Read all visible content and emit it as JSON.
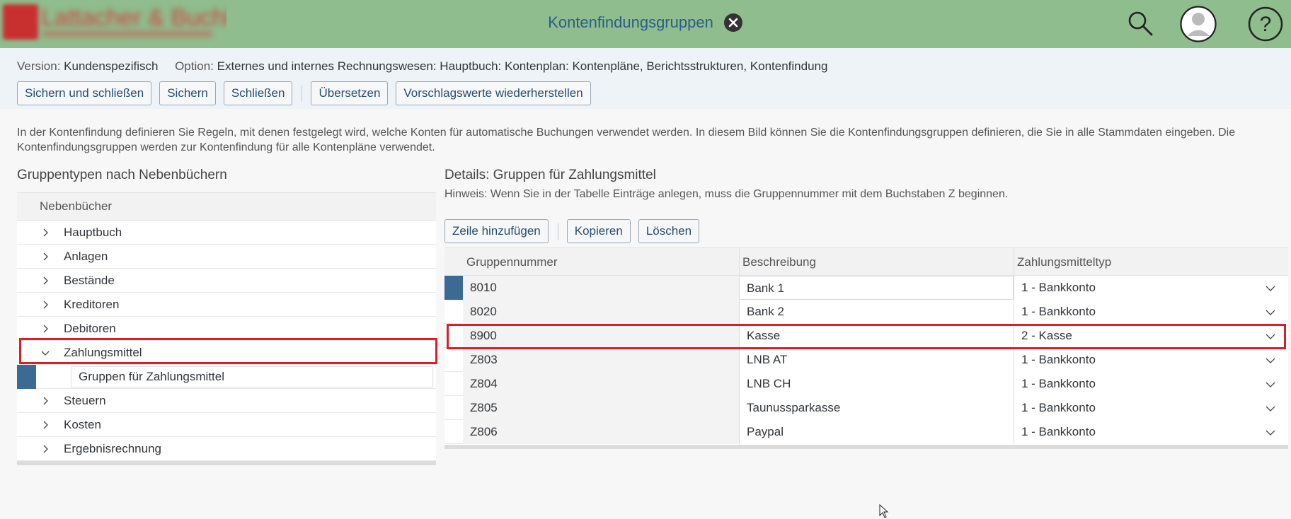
{
  "shell": {
    "title": "Kontenfindungsgruppen",
    "logo_text": "Lattacher & Buchl",
    "icons": [
      "close-icon",
      "search-icon",
      "avatar-icon",
      "help-icon"
    ]
  },
  "subheader": {
    "version_label": "Version:",
    "version_value": "Kundenspezifisch",
    "option_label": "Option:",
    "option_value": "Externes und internes Rechnungswesen: Hauptbuch: Kontenplan: Kontenpläne, Berichtsstrukturen, Kontenfindung",
    "buttons": {
      "save_close": "Sichern und schließen",
      "save": "Sichern",
      "close": "Schließen",
      "translate": "Übersetzen",
      "restore": "Vorschlagswerte wiederherstellen"
    }
  },
  "description": "In der Kontenfindung definieren Sie Regeln, mit denen festgelegt wird, welche Konten für automatische Buchungen verwendet werden. In diesem Bild können Sie die Kontenfindungsgruppen definieren, die Sie in alle Stammdaten eingeben. Die Kontenfindungsgruppen werden zur Kontenfindung für alle Kontenpläne verwendet.",
  "left": {
    "title": "Gruppentypen nach Nebenbüchern",
    "column_header": "Nebenbücher",
    "items": [
      {
        "label": "Hauptbuch",
        "expanded": false
      },
      {
        "label": "Anlagen",
        "expanded": false
      },
      {
        "label": "Bestände",
        "expanded": false
      },
      {
        "label": "Kreditoren",
        "expanded": false
      },
      {
        "label": "Debitoren",
        "expanded": false
      },
      {
        "label": "Zahlungsmittel",
        "expanded": true
      },
      {
        "label": "Gruppen für Zahlungsmittel",
        "child": true
      },
      {
        "label": "Steuern",
        "expanded": false
      },
      {
        "label": "Kosten",
        "expanded": false
      },
      {
        "label": "Ergebnisrechnung",
        "expanded": false
      }
    ]
  },
  "right": {
    "title": "Details: Gruppen für Zahlungsmittel",
    "hint": "Hinweis: Wenn Sie in der Tabelle Einträge anlegen, muss die Gruppennummer mit dem Buchstaben Z beginnen.",
    "buttons": {
      "add_row": "Zeile hinzufügen",
      "copy": "Kopieren",
      "delete": "Löschen"
    },
    "columns": [
      "Gruppennummer",
      "Beschreibung",
      "Zahlungsmitteltyp"
    ],
    "rows": [
      {
        "number": "8010",
        "description": "Bank 1",
        "type": "1 - Bankkonto",
        "selected": true
      },
      {
        "number": "8020",
        "description": "Bank 2",
        "type": "1 - Bankkonto"
      },
      {
        "number": "8900",
        "description": "Kasse",
        "type": "2 - Kasse",
        "highlighted": true
      },
      {
        "number": "Z803",
        "description": "LNB AT",
        "type": "1 - Bankkonto"
      },
      {
        "number": "Z804",
        "description": "LNB CH",
        "type": "1 - Bankkonto"
      },
      {
        "number": "Z805",
        "description": "Taunussparkasse",
        "type": "1 - Bankkonto"
      },
      {
        "number": "Z806",
        "description": "Paypal",
        "type": "1 - Bankkonto"
      }
    ]
  },
  "colors": {
    "shell_bg": "#8fbd8d",
    "accent_blue": "#3b6a95",
    "highlight_red": "#d9202a"
  }
}
